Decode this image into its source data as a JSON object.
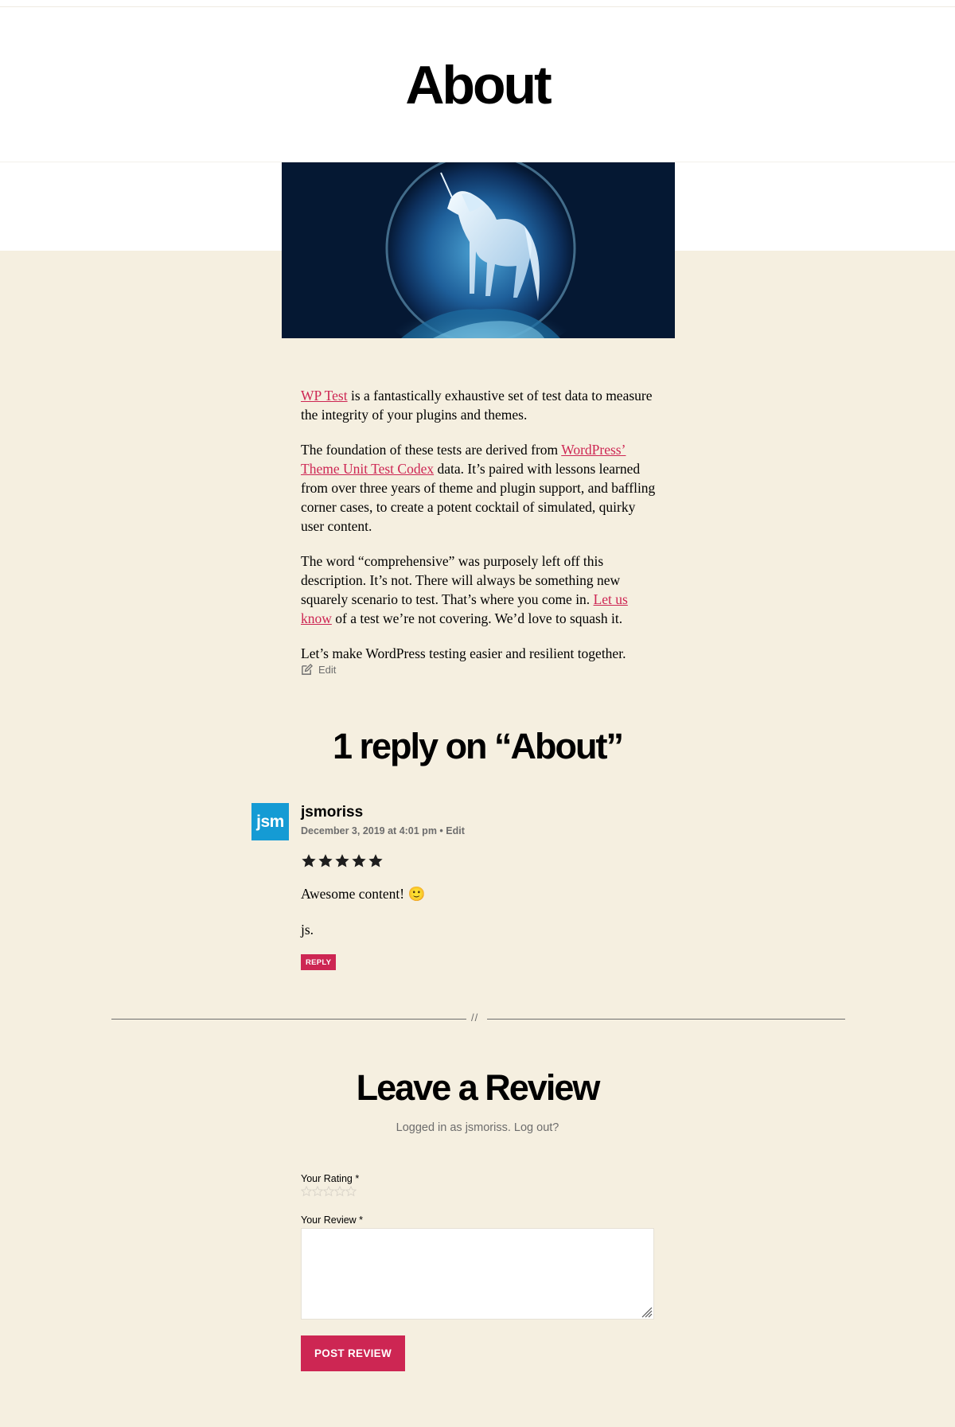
{
  "page": {
    "title": "About"
  },
  "colors": {
    "accent": "#cd2653",
    "background": "#f5efe0",
    "header": "#ffffff",
    "avatar": "#159bd4"
  },
  "content": {
    "p1": {
      "link": "WP Test",
      "text": " is a fantastically exhaustive set of test data to measure the integrity of your plugins and themes."
    },
    "p2": {
      "before": "The foundation of these tests are derived from ",
      "link": "WordPress’ Theme Unit Test Codex",
      "after": " data. It’s paired with lessons learned from over three years of theme and plugin support, and baffling corner cases, to create a potent cocktail of simulated, quirky user content."
    },
    "p3": {
      "before": "The word “comprehensive” was purposely left off this description. It’s not. There will always be something new squarely scenario to test. That’s where you come in. ",
      "link": "Let us know",
      "after": " of a test we’re not covering. We’d love to squash it."
    },
    "p4": "Let’s make WordPress testing easier and resilient together.",
    "edit_label": "Edit"
  },
  "comments": {
    "title": "1 reply on “About”",
    "items": [
      {
        "avatar_text": "jsm",
        "author": "jsmoriss",
        "date": "December 3, 2019 at 4:01 pm",
        "meta_sep": " • ",
        "edit_label": "Edit",
        "rating": 5,
        "rating_max": 5,
        "text1": "Awesome content! ",
        "emoji": "🙂",
        "text2": "js.",
        "reply_label": "REPLY"
      }
    ]
  },
  "separator": {
    "mark": "//"
  },
  "review_form": {
    "title": "Leave a Review",
    "logged_in_text": "Logged in as jsmoriss. Log out?",
    "rating_label": "Your Rating *",
    "rating_value": 0,
    "review_label": "Your Review *",
    "review_value": "",
    "submit_label": "POST REVIEW"
  }
}
